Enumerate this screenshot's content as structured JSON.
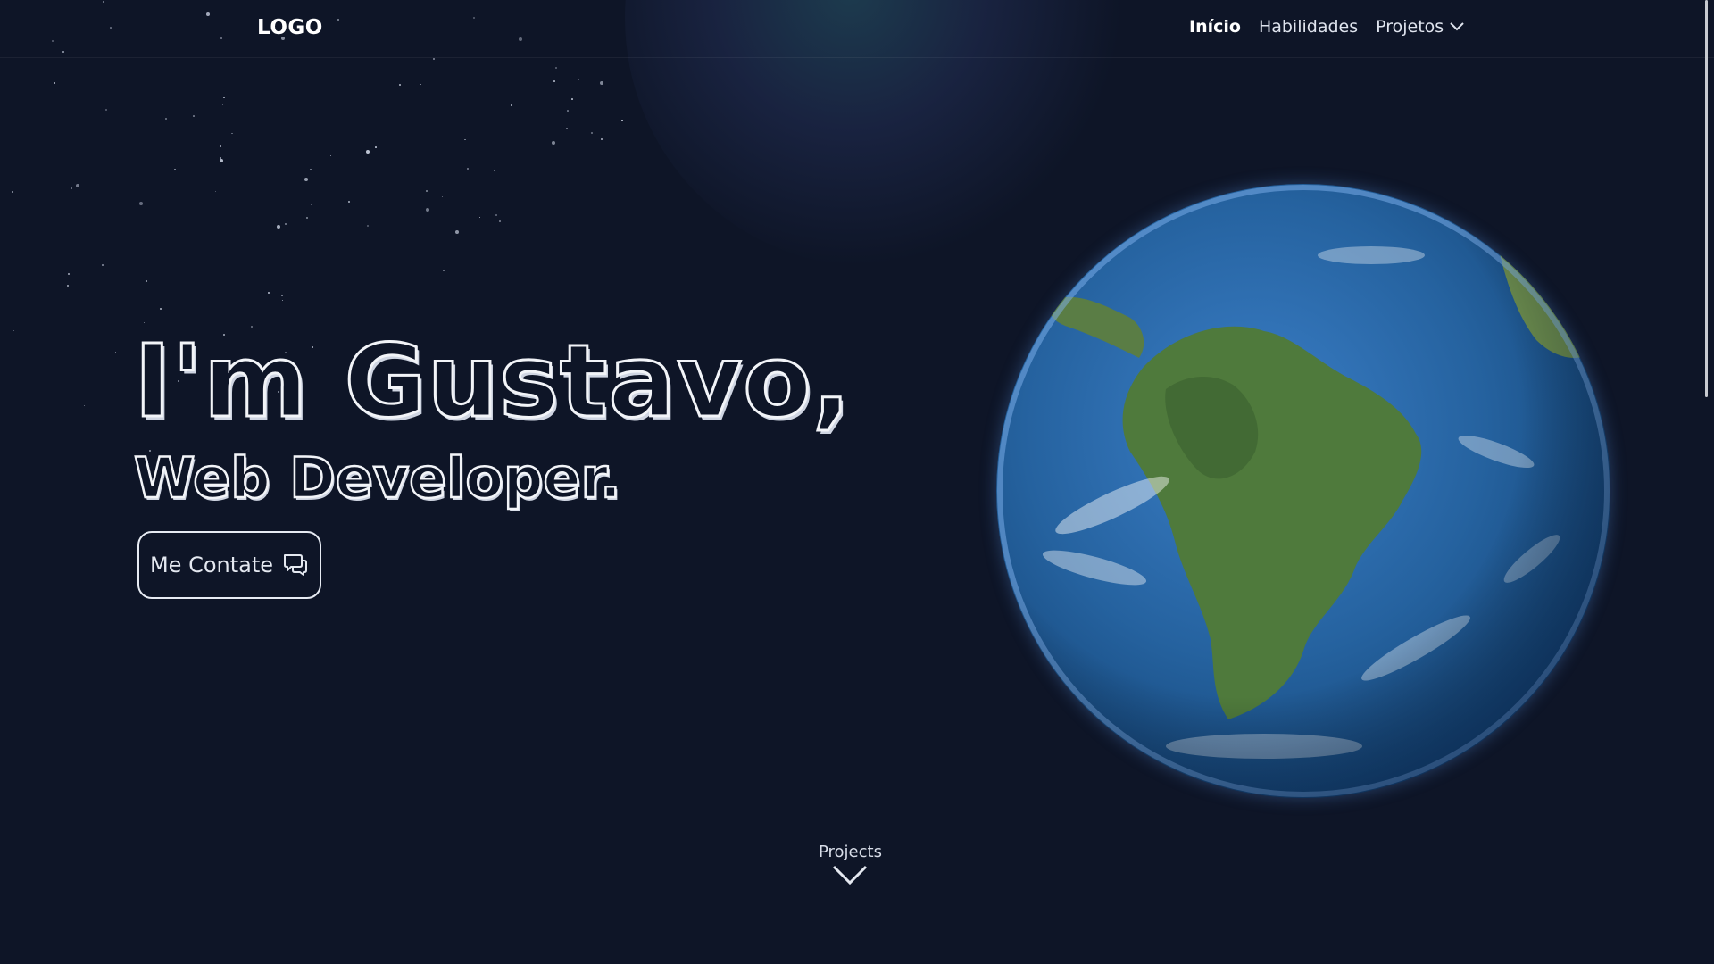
{
  "header": {
    "logo": "LOGO",
    "nav": [
      {
        "label": "Início",
        "active": true
      },
      {
        "label": "Habilidades",
        "active": false
      },
      {
        "label": "Projetos",
        "active": false,
        "has_dropdown": true
      }
    ]
  },
  "hero": {
    "title": "I'm Gustavo,",
    "subtitle": "Web Developer.",
    "contact_button": "Me Contate",
    "contact_icon": "chat-bubbles-icon"
  },
  "globe": {
    "image": "earth-globe-south-america"
  },
  "scroll_hint": {
    "label": "Projects",
    "icon": "chevron-down-icon"
  },
  "colors": {
    "background": "#0e1527",
    "text": "#ffffff",
    "ocean": "#25629f",
    "land": "#4f7a3c"
  }
}
